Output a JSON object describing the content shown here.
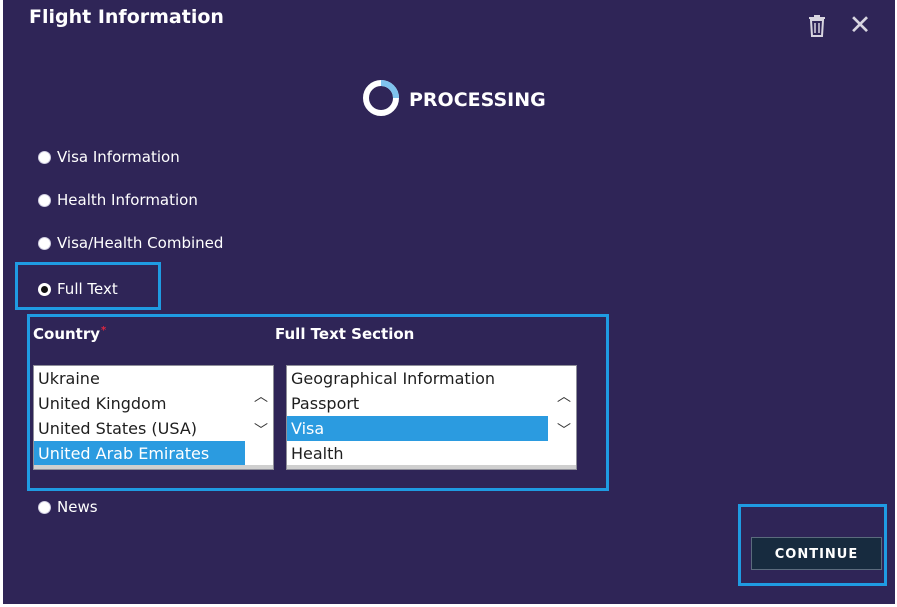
{
  "dialog": {
    "title": "Flight Information",
    "processing_label": "PROCESSING"
  },
  "options": [
    {
      "label": "Visa Information",
      "checked": false
    },
    {
      "label": "Health Information",
      "checked": false
    },
    {
      "label": "Visa/Health Combined",
      "checked": false
    },
    {
      "label": "Full Text",
      "checked": true
    },
    {
      "label": "News",
      "checked": false
    }
  ],
  "country": {
    "label": "Country",
    "required_mark": "*",
    "items": [
      "Ukraine",
      "United Kingdom",
      "United States (USA)",
      "United Arab Emirates"
    ],
    "selected": "United Arab Emirates"
  },
  "full_text_section": {
    "label": "Full Text Section",
    "items": [
      "Geographical Information",
      "Passport",
      "Visa",
      "Health"
    ],
    "selected": "Visa"
  },
  "buttons": {
    "continue_label": "CONTINUE"
  },
  "icons": {
    "trash": "trash-icon",
    "close": "close-icon",
    "processing": "spinner-icon",
    "scroll_up": "chevron-up-icon",
    "scroll_down": "chevron-down-icon"
  },
  "colors": {
    "dialog_bg": "#2f2557",
    "highlight": "#1f9be2",
    "selection": "#2b9be0",
    "button_bg": "#172b3f",
    "required": "#e0263f"
  }
}
